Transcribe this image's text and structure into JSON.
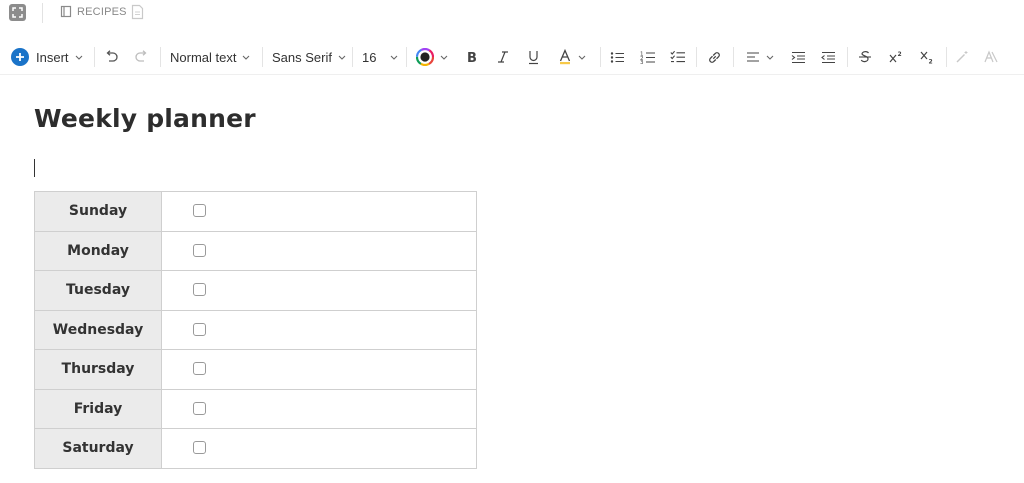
{
  "breadcrumb": {
    "label": "RECIPES"
  },
  "toolbar": {
    "insert_label": "Insert",
    "text_style": "Normal text",
    "font_family": "Sans Serif",
    "font_size": "16",
    "accent_color": "#1a73c8"
  },
  "document": {
    "title": "Weekly planner",
    "table": {
      "rows": [
        {
          "day": "Sunday",
          "checked": false
        },
        {
          "day": "Monday",
          "checked": false
        },
        {
          "day": "Tuesday",
          "checked": false
        },
        {
          "day": "Wednesday",
          "checked": false
        },
        {
          "day": "Thursday",
          "checked": false
        },
        {
          "day": "Friday",
          "checked": false
        },
        {
          "day": "Saturday",
          "checked": false
        }
      ]
    }
  }
}
